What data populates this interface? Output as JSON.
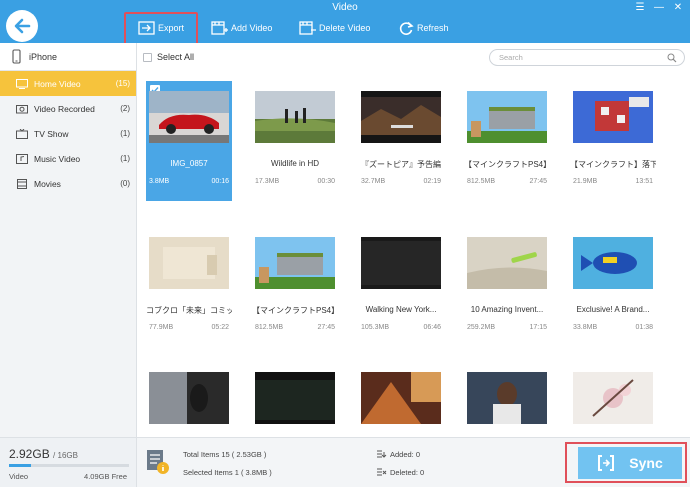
{
  "window": {
    "title": "Video"
  },
  "toolbar": {
    "export": "Export",
    "add_video": "Add Video",
    "delete_video": "Delete Video",
    "refresh": "Refresh"
  },
  "sidebar": {
    "device": "iPhone",
    "items": [
      {
        "label": "Home Video",
        "count": "(15)",
        "icon": "home-video-icon"
      },
      {
        "label": "Video Recorded",
        "count": "(2)",
        "icon": "camera-icon"
      },
      {
        "label": "TV Show",
        "count": "(1)",
        "icon": "tv-icon"
      },
      {
        "label": "Music Video",
        "count": "(1)",
        "icon": "music-video-icon"
      },
      {
        "label": "Movies",
        "count": "(0)",
        "icon": "film-icon"
      }
    ]
  },
  "main": {
    "select_all": "Select All",
    "search_placeholder": "Search",
    "videos": [
      {
        "title": "IMG_0857",
        "size": "3.8MB",
        "duration": "00:16",
        "selected": true
      },
      {
        "title": "Wildlife in HD",
        "size": "17.3MB",
        "duration": "00:30"
      },
      {
        "title": "『ズートピア』予告編",
        "size": "32.7MB",
        "duration": "02:19"
      },
      {
        "title": "【マインクラフトPS4】も...",
        "size": "812.5MB",
        "duration": "27:45"
      },
      {
        "title": "【マインクラフト】落下...",
        "size": "21.9MB",
        "duration": "13:51"
      },
      {
        "title": "コブクロ「未来」コミッ...",
        "size": "77.9MB",
        "duration": "05:22"
      },
      {
        "title": "【マインクラフトPS4】も...",
        "size": "812.5MB",
        "duration": "27:45"
      },
      {
        "title": "Walking New York...",
        "size": "105.3MB",
        "duration": "06:46"
      },
      {
        "title": "10 Amazing Invent...",
        "size": "259.2MB",
        "duration": "17:15"
      },
      {
        "title": "Exclusive! A Brand...",
        "size": "33.8MB",
        "duration": "01:38"
      },
      {
        "title": "",
        "size": "",
        "duration": ""
      },
      {
        "title": "",
        "size": "",
        "duration": ""
      },
      {
        "title": "",
        "size": "",
        "duration": ""
      },
      {
        "title": "",
        "size": "",
        "duration": ""
      },
      {
        "title": "",
        "size": "",
        "duration": ""
      }
    ]
  },
  "footer": {
    "storage_used": "2.92GB",
    "storage_total": "/ 16GB",
    "storage_used_fraction": 0.18,
    "storage_type": "Video",
    "storage_free": "4.09GB Free",
    "total_items": "Total Items  15 ( 2.53GB )",
    "selected_items": "Selected Items  1 ( 3.8MB )",
    "added": "Added: 0",
    "deleted": "Deleted: 0",
    "sync": "Sync"
  },
  "colors": {
    "accent": "#3aa0e3",
    "active_item": "#f6c33c",
    "highlight_outline": "#e0505a",
    "sync_button": "#72c3f1"
  }
}
